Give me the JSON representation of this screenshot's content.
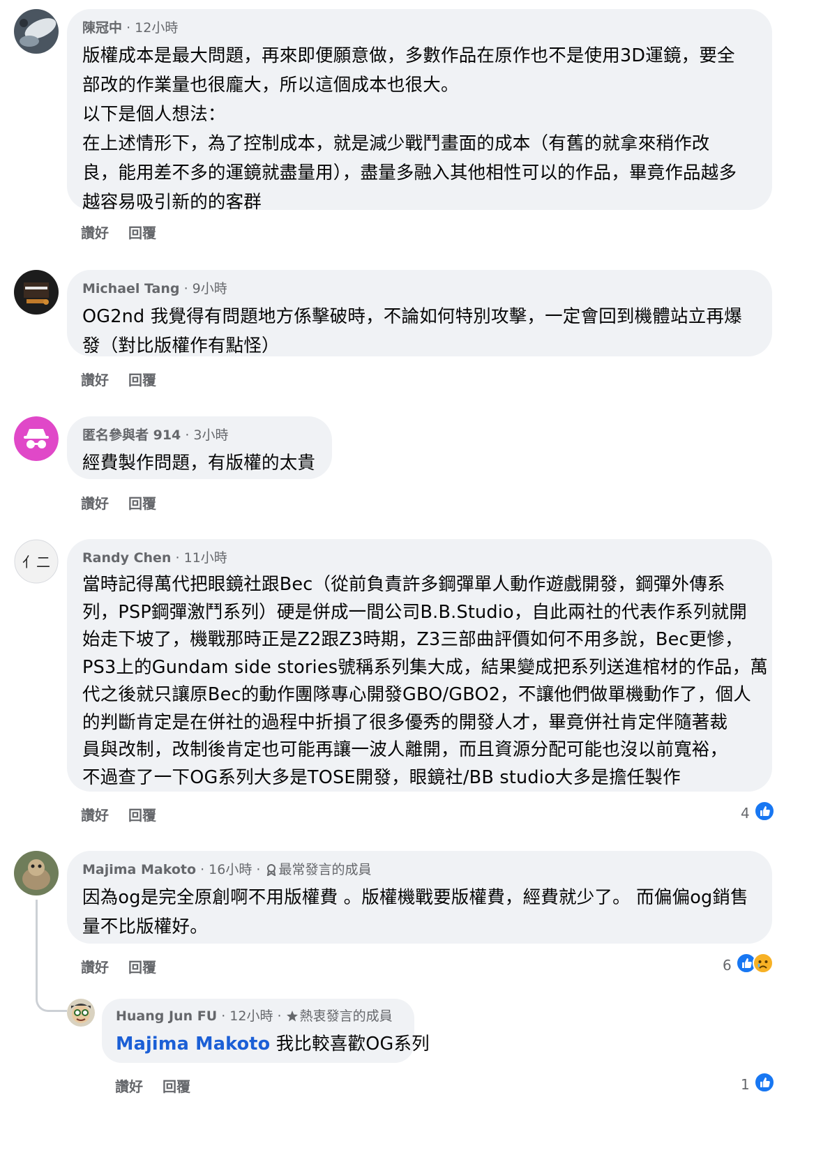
{
  "comments": [
    {
      "author": "陳冠中",
      "time": "12小時",
      "lines": [
        "版權成本是最大問題，再來即便願意做，多數作品在原作也不是使用3D運鏡，要全",
        "部改的作業量也很龐大，所以這個成本也很大。",
        "以下是個人想法：",
        "在上述情形下，為了控制成本，就是減少戰鬥畫面的成本（有舊的就拿來稍作改",
        "良，能用差不多的運鏡就盡量用），盡量多融入其他相性可以的作品，畢竟作品越多",
        "越容易吸引新的的客群"
      ],
      "like": "讚好",
      "reply": "回覆"
    },
    {
      "author": "Michael Tang",
      "time": "9小時",
      "lines": [
        "OG2nd 我覺得有問題地方係擊破時，不論如何特別攻擊，一定會回到機體站立再爆",
        "發（對比版權作有點怪）"
      ],
      "like": "讚好",
      "reply": "回覆"
    },
    {
      "author": "匿名參與者 914",
      "time": "3小時",
      "lines": [
        "經費製作問題，有版權的太貴"
      ],
      "like": "讚好",
      "reply": "回覆"
    },
    {
      "author": "Randy Chen",
      "time": "11小時",
      "lines": [
        "當時記得萬代把眼鏡社跟Bec（從前負責許多鋼彈單人動作遊戲開發，鋼彈外傳系",
        "列，PSP鋼彈激鬥系列）硬是併成一間公司B.B.Studio，自此兩社的代表作系列就開",
        "始走下坡了，機戰那時正是Z2跟Z3時期，Z3三部曲評價如何不用多說，Bec更慘，",
        "PS3上的Gundam side stories號稱系列集大成，結果變成把系列送進棺材的作品，萬",
        "代之後就只讓原Bec的動作團隊專心開發GBO/GBO2，不讓他們做單機動作了，個人",
        "的判斷肯定是在併社的過程中折損了很多優秀的開發人才，畢竟併社肯定伴隨著裁",
        "員與改制，改制後肯定也可能再讓一波人離開，而且資源分配可能也沒以前寬裕，",
        "不過查了一下OG系列大多是TOSE開發，眼鏡社/BB studio大多是擔任製作"
      ],
      "like": "讚好",
      "reply": "回覆",
      "reaction_count": "4"
    },
    {
      "author": "Majima Makoto",
      "time": "16小時",
      "badge": "最常發言的成員",
      "lines": [
        "因為og是完全原創啊不用版權費 。版權機戰要版權費，經費就少了。 而偏偏og銷售",
        "量不比版權好。"
      ],
      "like": "讚好",
      "reply": "回覆",
      "reaction_count": "6"
    }
  ],
  "reply": {
    "author": "Huang Jun FU",
    "time": "12小時",
    "badge": "熱衷發言的成員",
    "mention": "Majima Makoto",
    "text": " 我比較喜歡OG系列",
    "like": "讚好",
    "reply": "回覆",
    "reaction_count": "1"
  },
  "separator": "·",
  "colors": {
    "bubble": "#f0f2f5",
    "like_blue": "#1877f2",
    "meta_gray": "#65676b",
    "mention": "#1b5fd6",
    "anon_avatar": "#e048c8"
  }
}
